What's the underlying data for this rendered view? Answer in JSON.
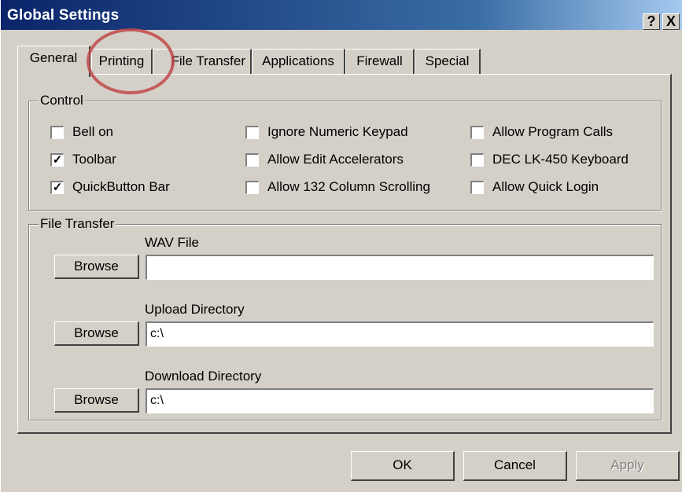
{
  "window": {
    "title": "Global Settings",
    "help_label": "?",
    "close_label": "X"
  },
  "tabs": [
    {
      "label": "General",
      "active": true
    },
    {
      "label": "Printing"
    },
    {
      "label": "File Transfer"
    },
    {
      "label": "Applications"
    },
    {
      "label": "Firewall"
    },
    {
      "label": "Special"
    }
  ],
  "control": {
    "label": "Control",
    "options": [
      {
        "label": "Bell on",
        "checked": false
      },
      {
        "label": "Toolbar",
        "checked": true
      },
      {
        "label": "QuickButton Bar",
        "checked": true
      },
      {
        "label": "Ignore Numeric Keypad",
        "checked": false
      },
      {
        "label": "Allow Edit Accelerators",
        "checked": false
      },
      {
        "label": "Allow 132 Column Scrolling",
        "checked": false
      },
      {
        "label": "Allow Program Calls",
        "checked": false
      },
      {
        "label": "DEC LK-450 Keyboard",
        "checked": false
      },
      {
        "label": "Allow Quick Login",
        "checked": false
      }
    ]
  },
  "file_transfer": {
    "label": "File Transfer",
    "browse_label": "Browse",
    "wav_label": "WAV File",
    "wav_value": "",
    "upload_label": "Upload Directory",
    "upload_value": "c:\\",
    "download_label": "Download Directory",
    "download_value": "c:\\"
  },
  "buttons": {
    "ok": "OK",
    "cancel": "Cancel",
    "apply": "Apply"
  },
  "check_mark": "✓",
  "annotation": {
    "color": "#c04a4a"
  }
}
